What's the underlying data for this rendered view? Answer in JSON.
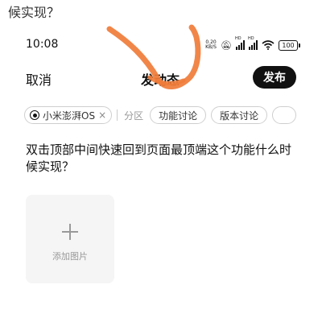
{
  "caption": "候实现？",
  "status_bar": {
    "time": "10:08",
    "net_speed_value": "0.20",
    "net_speed_unit": "KB/S",
    "signal1_label": "HD",
    "signal2_label": "HD",
    "battery": "100"
  },
  "nav": {
    "cancel_label": "取消",
    "title": "发动态",
    "publish_label": "发布"
  },
  "tags": {
    "selected_topic": "小米澎湃OS",
    "close_symbol": "×",
    "section_label": "分区",
    "options": [
      "功能讨论",
      "版本讨论"
    ]
  },
  "post": {
    "text": "双击顶部中间快速回到页面最顶端这个功能什么时候实现？"
  },
  "add_image": {
    "label": "添加图片"
  },
  "colors": {
    "scribble": "#f07c3a",
    "publish_bg": "#111111"
  }
}
